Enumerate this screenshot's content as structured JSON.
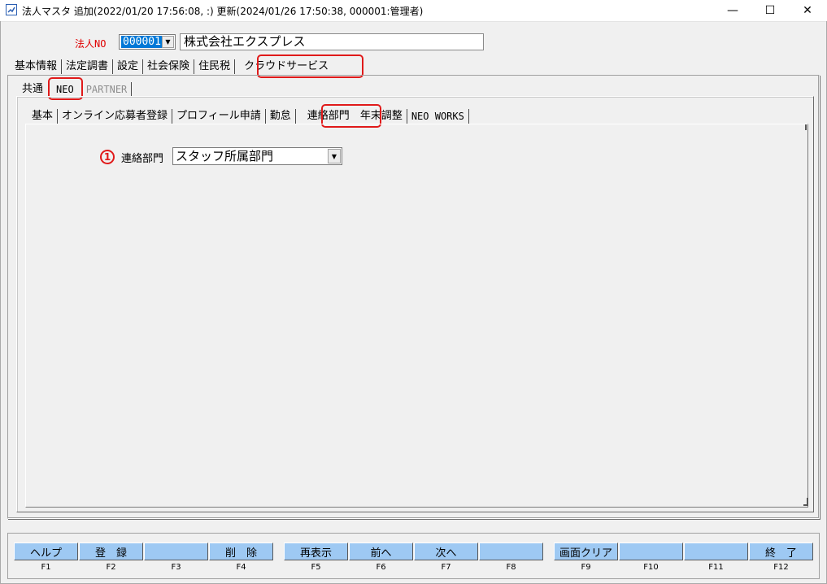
{
  "window": {
    "title": "法人マスタ 追加(2022/01/20 17:56:08, :) 更新(2024/01/26 17:50:38, 000001:管理者)",
    "controls": {
      "minimize": "—",
      "maximize": "☐",
      "close": "✕"
    }
  },
  "header": {
    "corp_no_label": "法人NO",
    "corp_no_value": "000001",
    "corp_name": "株式会社エクスプレス"
  },
  "main_tabs": [
    {
      "label": "基本情報"
    },
    {
      "label": "法定調書"
    },
    {
      "label": "設定"
    },
    {
      "label": "社会保険"
    },
    {
      "label": "住民税"
    },
    {
      "label": "クラウドサービス"
    }
  ],
  "service_tabs": [
    {
      "label": "共通"
    },
    {
      "label": "NEO"
    },
    {
      "label": "PARTNER"
    }
  ],
  "neo_tabs": [
    {
      "label": "基本"
    },
    {
      "label": "オンライン応募者登録"
    },
    {
      "label": "プロフィール申請"
    },
    {
      "label": "勤怠"
    },
    {
      "label": "連絡部門"
    },
    {
      "label": "年末調整"
    },
    {
      "label": "NEO WORKS"
    }
  ],
  "field": {
    "marker": "1",
    "label": "連絡部門",
    "value": "スタッフ所属部門"
  },
  "function_keys": [
    {
      "label": "ヘルプ",
      "key": "F1"
    },
    {
      "label": "登　録",
      "key": "F2"
    },
    {
      "label": "",
      "key": "F3"
    },
    {
      "label": "削　除",
      "key": "F4"
    },
    {
      "label": "再表示",
      "key": "F5"
    },
    {
      "label": "前へ",
      "key": "F6"
    },
    {
      "label": "次へ",
      "key": "F7"
    },
    {
      "label": "",
      "key": "F8"
    },
    {
      "label": "画面クリア",
      "key": "F9"
    },
    {
      "label": "",
      "key": "F10"
    },
    {
      "label": "",
      "key": "F11"
    },
    {
      "label": "終　了",
      "key": "F12"
    }
  ],
  "colors": {
    "highlight": "#e01a1a",
    "fkey": "#9ec9f3",
    "selection": "#0078d7"
  }
}
